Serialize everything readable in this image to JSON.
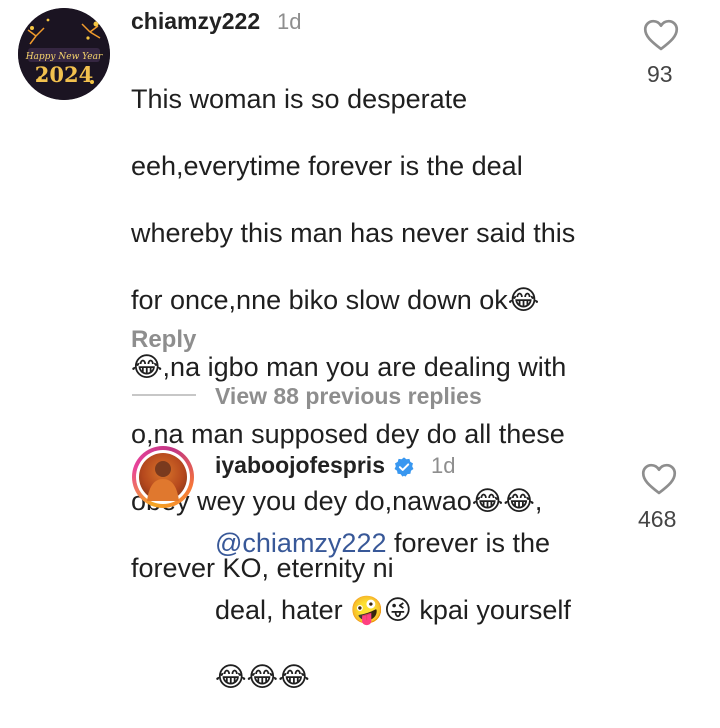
{
  "comment1": {
    "username": "chiamzy222",
    "time": "1d",
    "avatar_text": "Happy New Year 2024",
    "lines": [
      "This woman is so desperate",
      "eeh,everytime forever is the deal",
      "whereby this man has never said this",
      "for once,nne biko slow down ok😂",
      "😂,na igbo man you are dealing with",
      "o,na man supposed dey do all these",
      "obey wey you dey do,nawao😂😂,",
      "forever KO, eternity ni"
    ],
    "likes": "93",
    "reply_label": "Reply"
  },
  "thread": {
    "view_replies_label": "View 88 previous replies"
  },
  "comment2": {
    "username": "iyaboojofespris",
    "time": "1d",
    "mention": "@chiamzy222",
    "lines": [
      " forever is the",
      "deal, hater 🤪😜 kpai yourself",
      "😂😂😂"
    ],
    "likes": "468"
  },
  "icons": {
    "heart": "heart-outline-icon",
    "verified": "verified-badge-icon"
  },
  "colors": {
    "mention": "#385898",
    "verified": "#3897f0",
    "muted": "#8e8e8e"
  }
}
